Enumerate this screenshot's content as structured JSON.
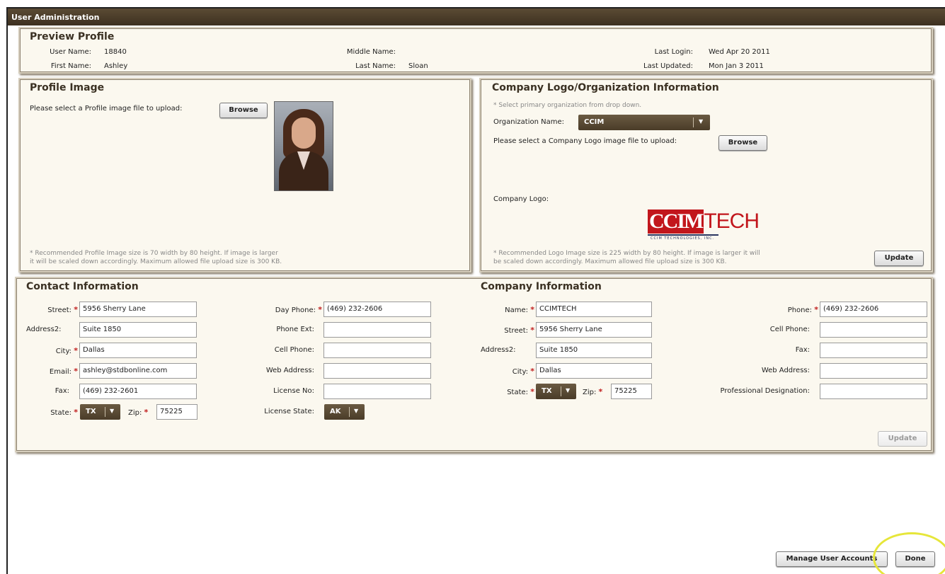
{
  "window": {
    "title": "User Administration"
  },
  "preview": {
    "title": "Preview Profile",
    "user_name_label": "User Name:",
    "user_name": "18840",
    "first_name_label": "First Name:",
    "first_name": "Ashley",
    "middle_name_label": "Middle Name:",
    "middle_name": "",
    "last_name_label": "Last Name:",
    "last_name": "Sloan",
    "last_login_label": "Last Login:",
    "last_login": "Wed Apr 20 2011",
    "last_updated_label": "Last Updated:",
    "last_updated": "Mon Jan 3 2011"
  },
  "profile_image": {
    "title": "Profile Image",
    "upload_label": "Please select a Profile image file to upload:",
    "browse": "Browse",
    "note1": "* Recommended Profile Image size is 70 width by 80 height. If image is larger",
    "note2": "it will be scaled down accordingly. Maximum allowed file upload size is 300 KB."
  },
  "company_logo": {
    "title": "Company Logo/Organization Information",
    "hint": "* Select primary organization from drop down.",
    "org_label": "Organization Name:",
    "org_value": "CCIM",
    "upload_label": "Please select a Company Logo image file to upload:",
    "browse": "Browse",
    "logo_label": "Company Logo:",
    "logo_text_a": "CCIM",
    "logo_text_b": "TECH",
    "logo_sub": "CCIM TECHNOLOGIES, INC.",
    "note1": "* Recommended Logo Image size is 225 width by 80 height. If image is larger it will",
    "note2": "be scaled down accordingly. Maximum allowed file upload size is 300 KB.",
    "update": "Update"
  },
  "contact": {
    "title": "Contact Information",
    "street_label": "Street:",
    "street": "5956 Sherry Lane",
    "address2_label": "Address2:",
    "address2": "Suite 1850",
    "city_label": "City:",
    "city": "Dallas",
    "email_label": "Email:",
    "email": "ashley@stdbonline.com",
    "fax_label": "Fax:",
    "fax": "(469) 232-2601",
    "state_label": "State:",
    "state": "TX",
    "zip_label": "Zip:",
    "zip": "75225",
    "day_phone_label": "Day Phone:",
    "day_phone": "(469) 232-2606",
    "phone_ext_label": "Phone Ext:",
    "phone_ext": "",
    "cell_phone_label": "Cell Phone:",
    "cell_phone": "",
    "web_address_label": "Web Address:",
    "web_address": "",
    "license_no_label": "License No:",
    "license_no": "",
    "license_state_label": "License State:",
    "license_state": "AK"
  },
  "company": {
    "title": "Company Information",
    "name_label": "Name:",
    "name": "CCIMTECH",
    "street_label": "Street:",
    "street": "5956 Sherry Lane",
    "address2_label": "Address2:",
    "address2": "Suite 1850",
    "city_label": "City:",
    "city": "Dallas",
    "state_label": "State:",
    "state": "TX",
    "zip_label": "Zip:",
    "zip": "75225",
    "phone_label": "Phone:",
    "phone": "(469) 232-2606",
    "cell_phone_label": "Cell Phone:",
    "cell_phone": "",
    "fax_label": "Fax:",
    "fax": "",
    "web_address_label": "Web Address:",
    "web_address": "",
    "designation_label": "Professional Designation:",
    "designation": "",
    "update": "Update"
  },
  "footer": {
    "manage": "Manage User Accounts",
    "done": "Done"
  },
  "colors": {
    "title_bar": "#4a3c28",
    "required": "#c02020",
    "accent": "#e6e63a"
  },
  "icons": {
    "dropdown": "chevron-down-icon",
    "required": "asterisk-icon"
  }
}
